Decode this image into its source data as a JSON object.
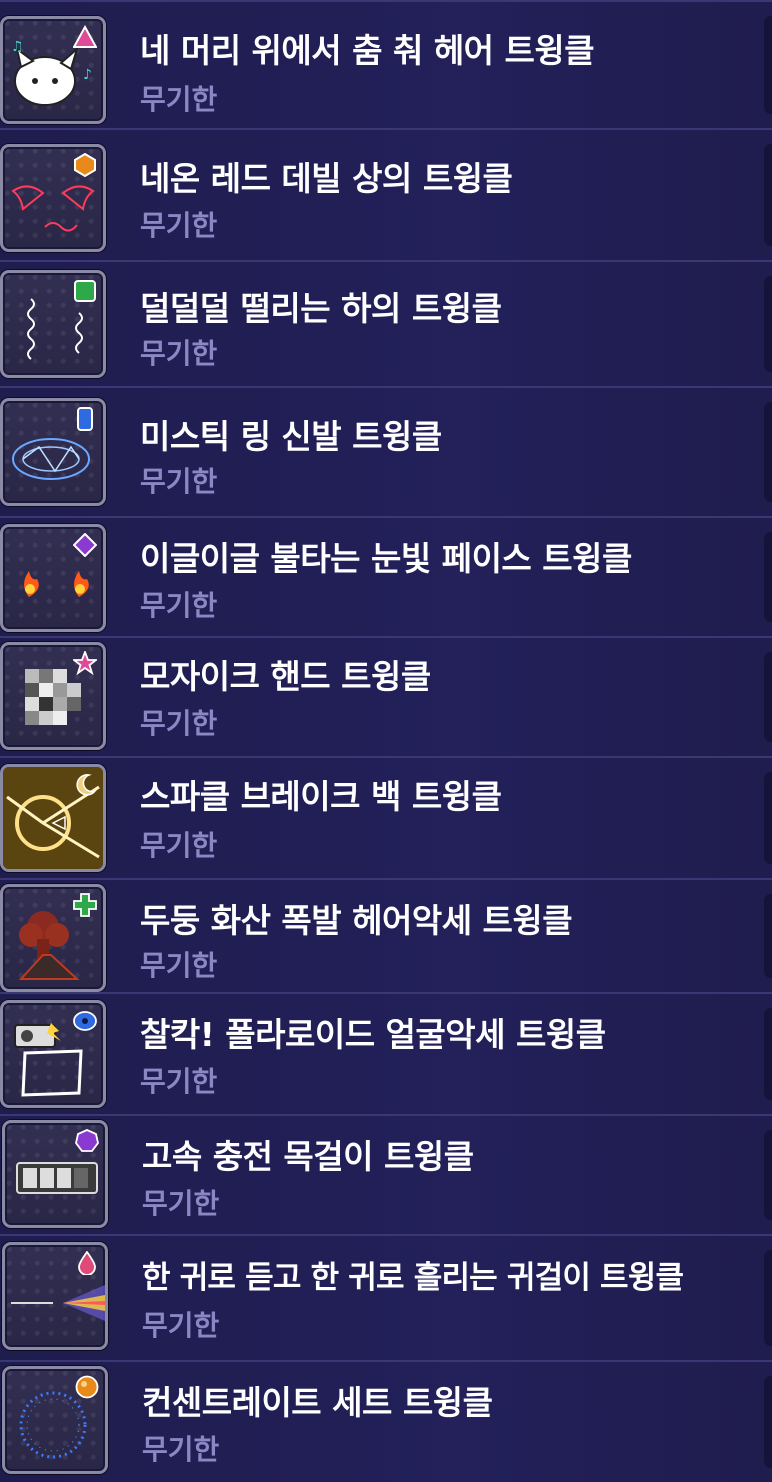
{
  "items": [
    {
      "title": "네 머리 위에서 춤 춰 헤어 트윙클",
      "period": "무기한",
      "icon": "dancing-cat-head-icon",
      "badge": "triangle-gem-icon",
      "badge_color": "#e04a9a"
    },
    {
      "title": "네온 레드 데빌 상의 트윙클",
      "period": "무기한",
      "icon": "neon-devil-wings-icon",
      "badge": "hexagon-gem-icon",
      "badge_color": "#e88a1a"
    },
    {
      "title": "덜덜덜 떨리는 하의 트윙클",
      "period": "무기한",
      "icon": "shaking-lines-icon",
      "badge": "square-gem-icon",
      "badge_color": "#2fa84a"
    },
    {
      "title": "미스틱 링 신발 트윙클",
      "period": "무기한",
      "icon": "mystic-ring-icon",
      "badge": "rect-gem-icon",
      "badge_color": "#2f6ae0"
    },
    {
      "title": "이글이글 불타는 눈빛 페이스 트윙클",
      "period": "무기한",
      "icon": "burning-eyes-icon",
      "badge": "diamond-gem-icon",
      "badge_color": "#8a3ad0"
    },
    {
      "title": "모자이크 핸드 트윙클",
      "period": "무기한",
      "icon": "mosaic-hand-icon",
      "badge": "star-gem-icon",
      "badge_color": "#e04a9a"
    },
    {
      "title": "스파클 브레이크 백 트윙클",
      "period": "무기한",
      "icon": "sparkle-break-icon",
      "badge": "moon-gem-icon",
      "badge_color": "#f0d080"
    },
    {
      "title": "두둥 화산 폭발 헤어악세 트윙클",
      "period": "무기한",
      "icon": "volcano-icon",
      "badge": "cross-gem-icon",
      "badge_color": "#2fa84a"
    },
    {
      "title": "찰칵! 폴라로이드 얼굴악세 트윙클",
      "period": "무기한",
      "icon": "polaroid-camera-icon",
      "badge": "eye-gem-icon",
      "badge_color": "#2f6ae0"
    },
    {
      "title": "고속 충전 목걸이 트윙클",
      "period": "무기한",
      "icon": "battery-necklace-icon",
      "badge": "heptagon-gem-icon",
      "badge_color": "#8a3ad0"
    },
    {
      "title": "한 귀로 듣고 한 귀로 흘리는 귀걸이 트윙클",
      "period": "무기한",
      "icon": "prism-earring-icon",
      "badge": "drop-gem-icon",
      "badge_color": "#e04a7a"
    },
    {
      "title": "컨센트레이트 세트 트윙클",
      "period": "무기한",
      "icon": "concentrate-ring-icon",
      "badge": "circle-gem-icon",
      "badge_color": "#e88a1a"
    }
  ]
}
